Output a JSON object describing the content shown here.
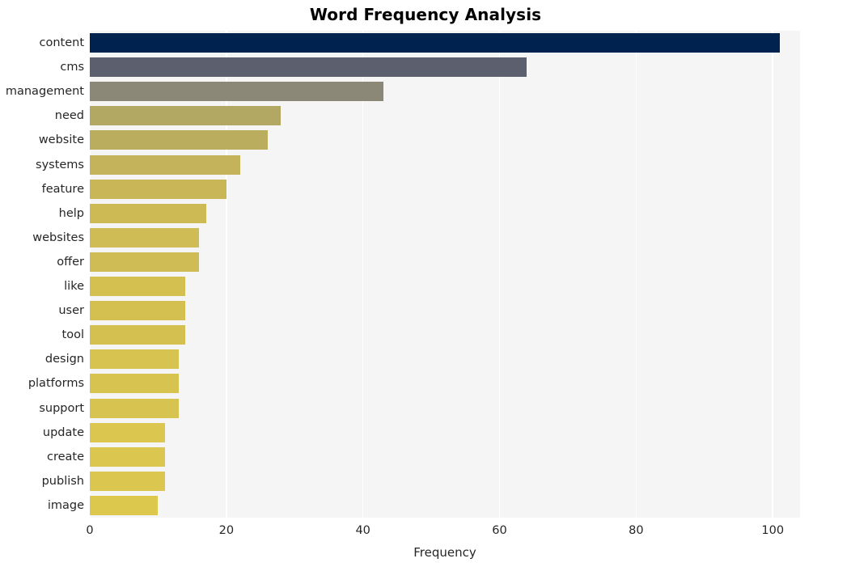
{
  "chart_data": {
    "type": "bar",
    "orientation": "horizontal",
    "title": "Word Frequency Analysis",
    "xlabel": "Frequency",
    "ylabel": "",
    "xlim": [
      0,
      104
    ],
    "xticks": [
      0,
      20,
      40,
      60,
      80,
      100
    ],
    "xtick_labels": [
      "0",
      "20",
      "40",
      "60",
      "80",
      "100"
    ],
    "grid": "vertical",
    "legend": "none",
    "categories": [
      "content",
      "cms",
      "management",
      "need",
      "website",
      "systems",
      "feature",
      "help",
      "websites",
      "offer",
      "like",
      "user",
      "tool",
      "design",
      "platforms",
      "support",
      "update",
      "create",
      "publish",
      "image"
    ],
    "values": [
      101,
      64,
      43,
      28,
      26,
      22,
      20,
      17,
      16,
      16,
      14,
      14,
      14,
      13,
      13,
      13,
      11,
      11,
      11,
      10
    ],
    "bar_colors": [
      "#00224e",
      "#5c5f6e",
      "#8c8878",
      "#b2a763",
      "#bbad5e",
      "#c4b35b",
      "#c8b657",
      "#cdba55",
      "#cfbc54",
      "#cfbc54",
      "#d4c051",
      "#d4c051",
      "#d4c051",
      "#d7c350",
      "#d7c350",
      "#d7c350",
      "#dbc64f",
      "#dbc64f",
      "#dbc64f",
      "#ddc84e"
    ],
    "colormap": "cividis",
    "plot_background": "#f5f5f5",
    "gridline_color": "#ffffff",
    "figure_background": "#ffffff",
    "text_color": "#262626"
  }
}
